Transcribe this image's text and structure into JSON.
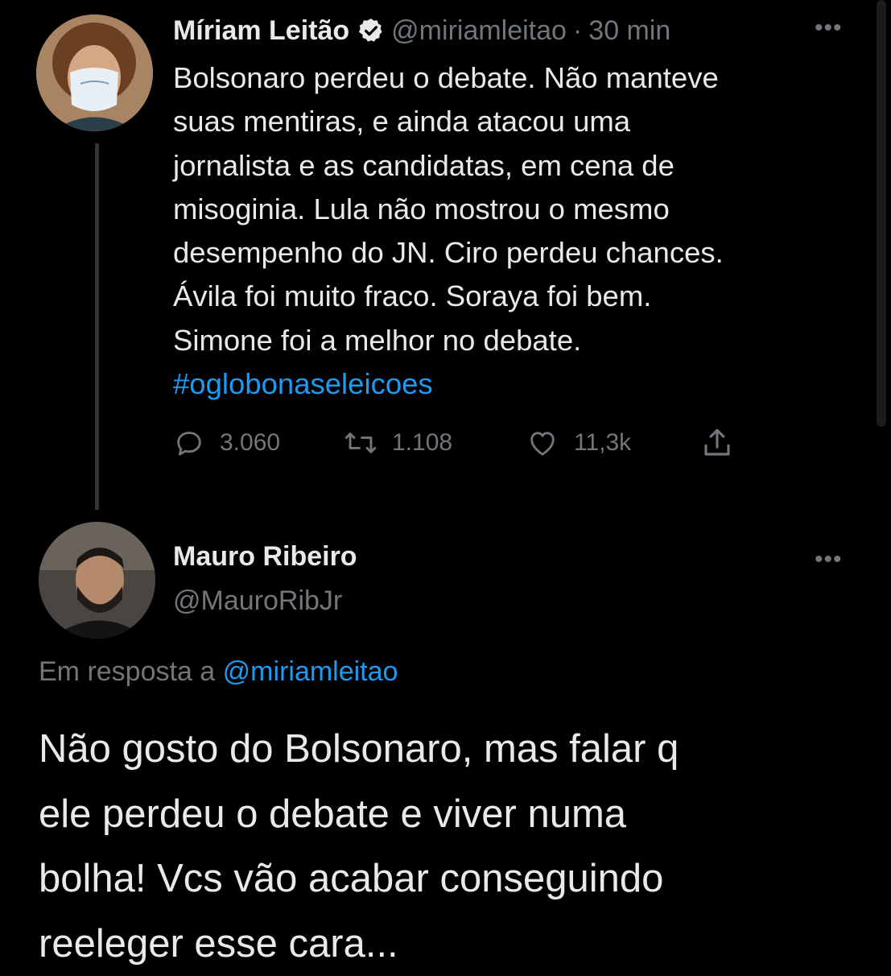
{
  "tweet": {
    "author_name": "Míriam Leitão",
    "handle": "@miriamleitao",
    "separator": "·",
    "time": "30 min",
    "more": "•••",
    "lines": [
      "Bolsonaro perdeu o debate. Não manteve",
      "suas mentiras, e ainda atacou uma",
      "jornalista e as candidatas, em cena de",
      "misoginia. Lula não mostrou o mesmo",
      "desempenho do JN. Ciro perdeu chances.",
      "Ávila foi muito fraco. Soraya foi bem.",
      "Simone foi a melhor no debate."
    ],
    "hashtag": "#oglobonaseleicoes",
    "replies": "3.060",
    "retweets": "1.108",
    "likes": "11,3k"
  },
  "reply": {
    "author_name": "Mauro Ribeiro",
    "handle": "@MauroRibJr",
    "more": "•••",
    "in_reply_prefix": "Em resposta a",
    "in_reply_mention": "@miriamleitao",
    "lines": [
      "Não gosto do Bolsonaro, mas falar q",
      "ele perdeu o debate e viver numa",
      "bolha! Vcs vão acabar conseguindo",
      "reeleger esse cara..."
    ]
  },
  "colors": {
    "background": "#000000",
    "text": "#e7e9ea",
    "muted": "#71767b",
    "link": "#1d9bf0"
  },
  "icons": [
    "verified-badge-icon",
    "reply-icon",
    "retweet-icon",
    "like-icon",
    "share-icon",
    "more-icon"
  ]
}
